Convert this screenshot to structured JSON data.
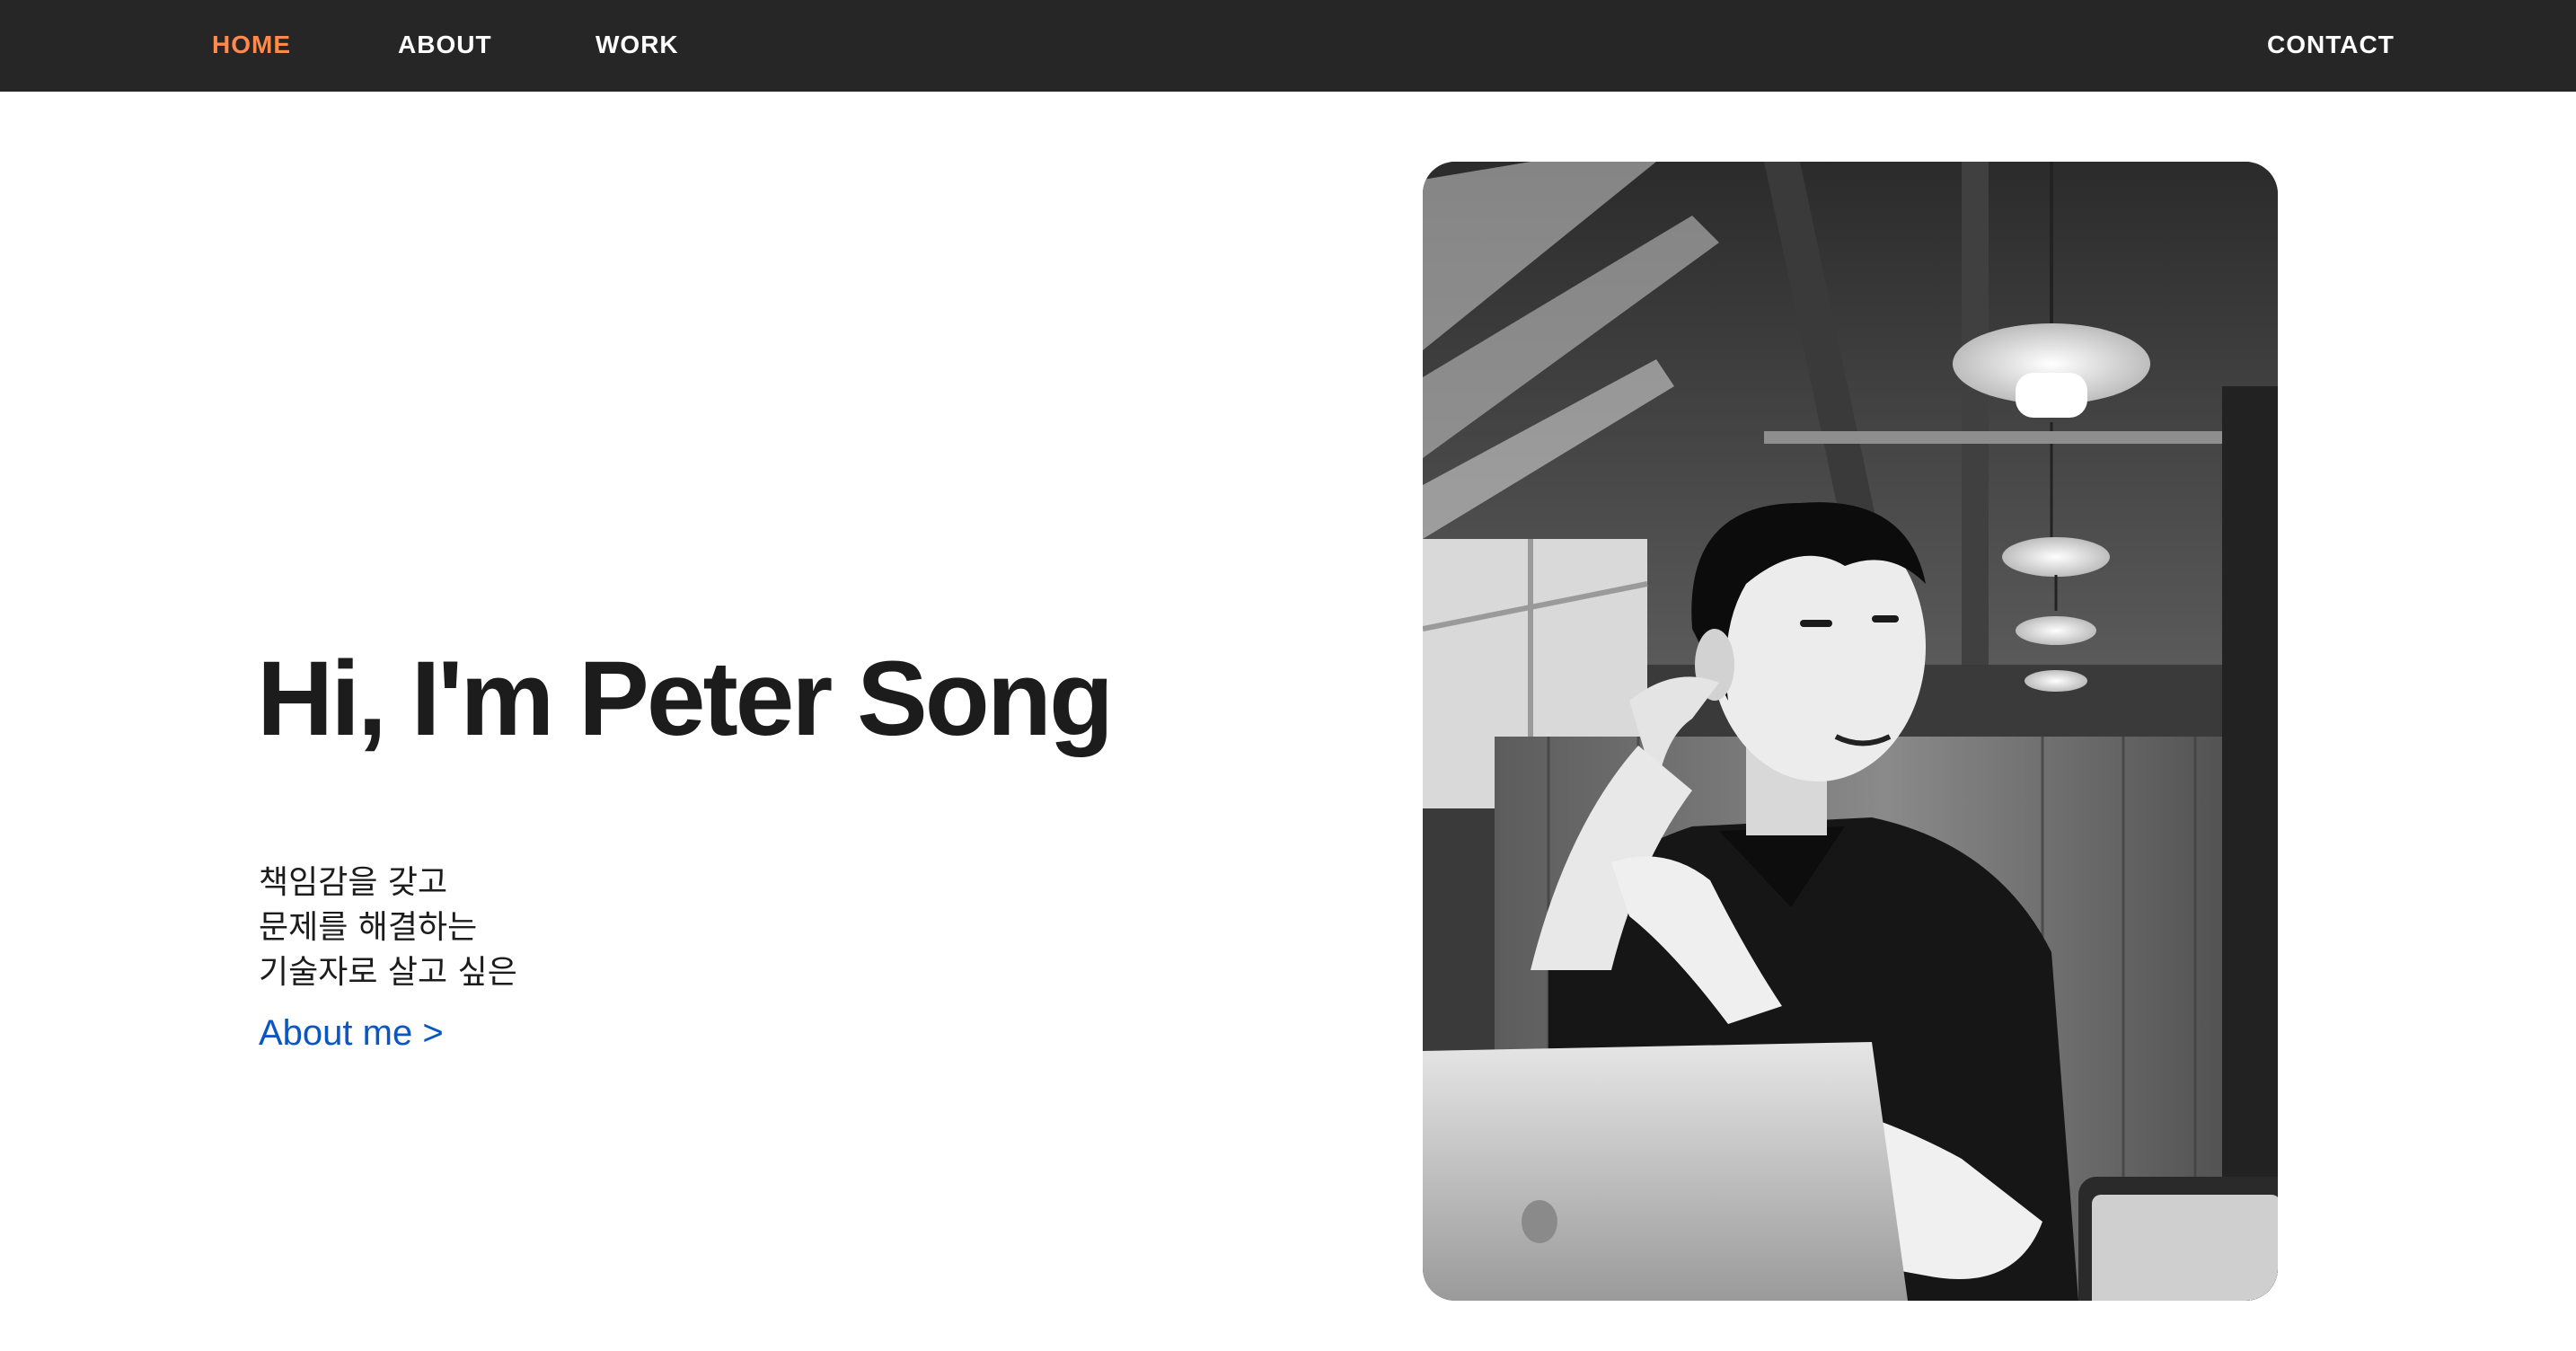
{
  "nav": {
    "home": "HOME",
    "about": "ABOUT",
    "work": "WORK",
    "contact": "CONTACT",
    "active": "HOME",
    "active_color": "#ff8a4c",
    "bar_color": "#262626"
  },
  "hero": {
    "title": "Hi, I'm Peter Song",
    "tagline": [
      "책임감을 갖고",
      "문제를 해결하는",
      "기술자로 살고 싶은"
    ],
    "link": "About me >",
    "link_color": "#0a56c4"
  },
  "photo": {
    "style": "black-and-white"
  }
}
